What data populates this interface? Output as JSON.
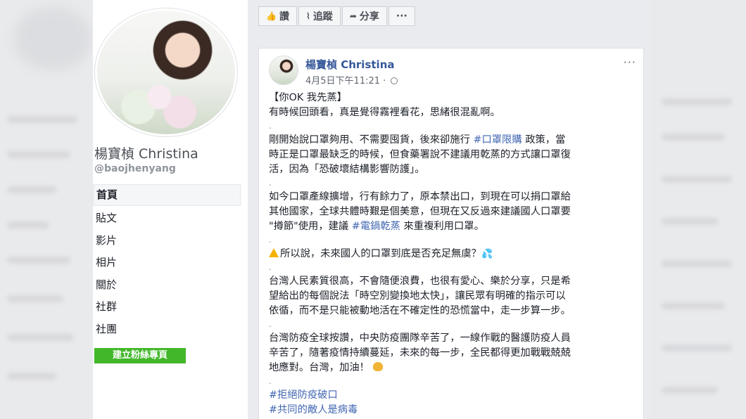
{
  "action_bar": {
    "like_label": "讚",
    "follow_label": "追蹤",
    "share_label": "分享",
    "more_label": "···"
  },
  "sidebar": {
    "page_name": "楊寶楨 Christina",
    "handle": "@baojhenyang",
    "items": [
      {
        "label": "首頁",
        "active": true
      },
      {
        "label": "貼文"
      },
      {
        "label": "影片"
      },
      {
        "label": "相片"
      },
      {
        "label": "關於"
      },
      {
        "label": "社群"
      },
      {
        "label": "社團"
      }
    ],
    "create_button": "建立粉絲專頁"
  },
  "post": {
    "author": "楊寶楨 Christina",
    "time": "4月5日下午11:21 ·",
    "more": "···",
    "l1": "【你OK 我先蒸】",
    "l2": "有時候回頭看，真是覺得霧裡看花，思緒很混亂啊。",
    "d1": "-",
    "l3a": "剛開始說口罩夠用、不需要囤貨，後來卻施行 ",
    "l3tag": "#口罩限購",
    "l3b": " 政策，當",
    "l4": "時正是口罩最缺乏的時候，但食藥署說不建議用乾蒸的方式讓口罩復",
    "l5": "活，因為「恐破壞結構影響防護」。",
    "d2": "-",
    "l6": "如今口罩產線擴增，行有餘力了，原本禁出口，到現在可以捐口罩給",
    "l7": "其他國家，全球共體時艱是個美意，但現在又反過來建議國人口罩要",
    "l8a": "\"撙節\"使用，建議 ",
    "l8tag": "#電鍋乾蒸",
    "l8b": " 來重複利用口罩。",
    "d3": "-",
    "l9": "所以說，未來國人的口罩到底是否充足無虞？",
    "d4": "-",
    "l10": "台灣人民素質很高，不會隨便浪費，也很有愛心、樂於分享，只是希",
    "l11": "望給出的每個說法「時空別變換地太快」，讓民眾有明確的指示可以",
    "l12": "依循，而不是只能被動地活在不確定性的恐慌當中，走一步算一步。",
    "d5": "-",
    "l13": "台灣防疫全球按讚，中央防疫團隊辛苦了，一線作戰的醫護防疫人員",
    "l14": "辛苦了，隨著疫情持續蔓延，未來的每一步，全民都得更加戰戰兢兢",
    "l15": "地應對。台灣，加油！",
    "d6": "-",
    "tag1": "#拒絕防疫破口",
    "tag2": "#共同的敵人是病毒"
  }
}
